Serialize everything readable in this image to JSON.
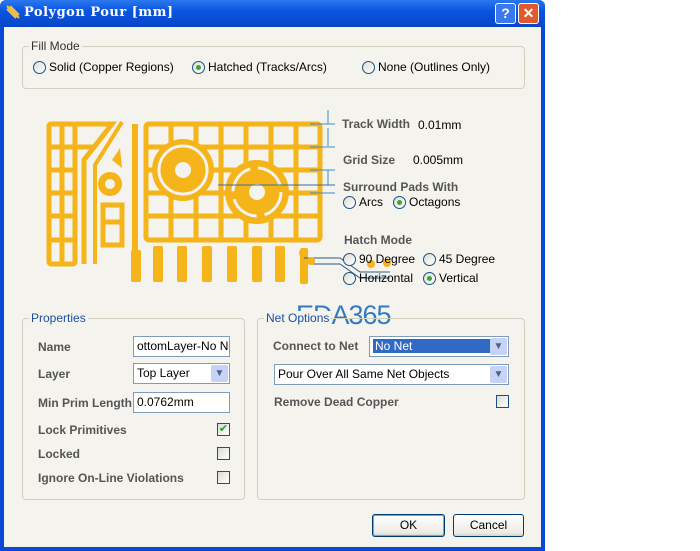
{
  "window": {
    "title": "Polygon Pour [mm]",
    "help": "?",
    "close": "✕"
  },
  "fill_mode": {
    "label": "Fill Mode",
    "options": [
      {
        "label": "Solid (Copper Regions)",
        "selected": false
      },
      {
        "label": "Hatched (Tracks/Arcs)",
        "selected": true
      },
      {
        "label": "None (Outlines Only)",
        "selected": false
      }
    ]
  },
  "preview": {
    "track_width_label": "Track Width",
    "track_width_value": "0.01mm",
    "grid_size_label": "Grid Size",
    "grid_size_value": "0.005mm",
    "surround_label": "Surround Pads With",
    "surround_options": [
      {
        "label": "Arcs",
        "selected": false
      },
      {
        "label": "Octagons",
        "selected": true
      }
    ],
    "hatch_label": "Hatch Mode",
    "hatch_options": [
      {
        "label": "90 Degree",
        "selected": false
      },
      {
        "label": "45 Degree",
        "selected": false
      },
      {
        "label": "Horizontal",
        "selected": false
      },
      {
        "label": "Vertical",
        "selected": true
      }
    ],
    "watermark": "EDA365",
    "copper_color": "#f5b419"
  },
  "properties": {
    "label": "Properties",
    "name_label": "Name",
    "name_value": "ottomLayer-No Net",
    "layer_label": "Layer",
    "layer_value": "Top Layer",
    "min_prim_label": "Min Prim Length",
    "min_prim_value": "0.0762mm",
    "lock_primitives_label": "Lock Primitives",
    "lock_primitives": true,
    "locked_label": "Locked",
    "locked": false,
    "ignore_label": "Ignore On-Line Violations",
    "ignore": false
  },
  "net_options": {
    "label": "Net Options",
    "connect_label": "Connect to Net",
    "connect_value": "No Net",
    "pour_value": "Pour Over All Same Net Objects",
    "remove_dead_label": "Remove Dead Copper",
    "remove_dead": false
  },
  "buttons": {
    "ok": "OK",
    "cancel": "Cancel"
  }
}
